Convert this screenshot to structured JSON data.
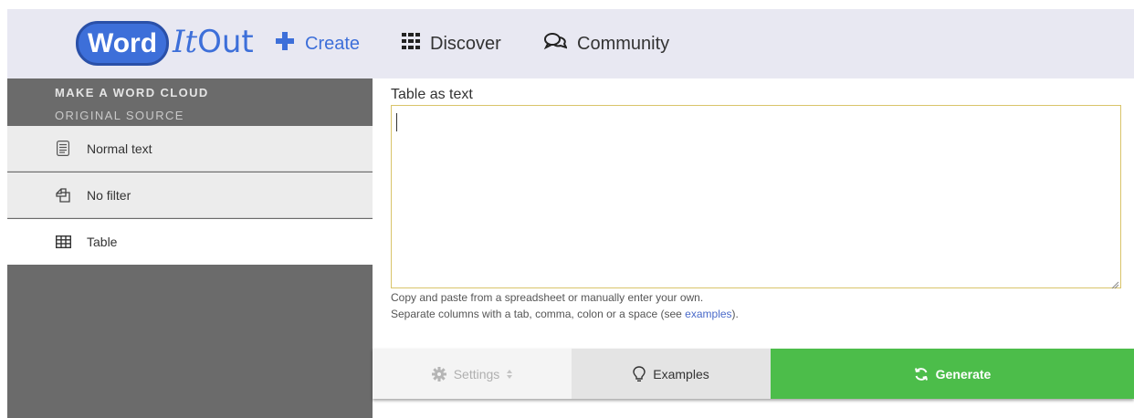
{
  "nav": {
    "logo_word": "Word",
    "logo_it": "It",
    "logo_out": "Out",
    "items": [
      {
        "label": "Create",
        "icon": "plus-icon"
      },
      {
        "label": "Discover",
        "icon": "grid-icon"
      },
      {
        "label": "Community",
        "icon": "chat-icon"
      }
    ]
  },
  "sidebar": {
    "title": "MAKE A WORD CLOUD",
    "subtitle": "ORIGINAL SOURCE",
    "items": [
      {
        "label": "Normal text",
        "icon": "document-icon",
        "active": false
      },
      {
        "label": "No filter",
        "icon": "copy-icon",
        "active": false
      },
      {
        "label": "Table",
        "icon": "table-icon",
        "active": true
      }
    ]
  },
  "main": {
    "field_label": "Table as text",
    "textarea_value": "",
    "help_line1": "Copy and paste from a spreadsheet or manually enter your own.",
    "help_line2_prefix": "Separate columns with a tab, comma, colon or a space (see ",
    "help_line2_link": "examples",
    "help_line2_suffix": ")."
  },
  "buttons": {
    "settings": "Settings",
    "examples": "Examples",
    "generate": "Generate"
  },
  "colors": {
    "brand_blue": "#3d6fd9",
    "generate_green": "#4cbd4a",
    "sidebar_dark": "#6b6b6b",
    "textarea_border": "#d9c46a"
  }
}
